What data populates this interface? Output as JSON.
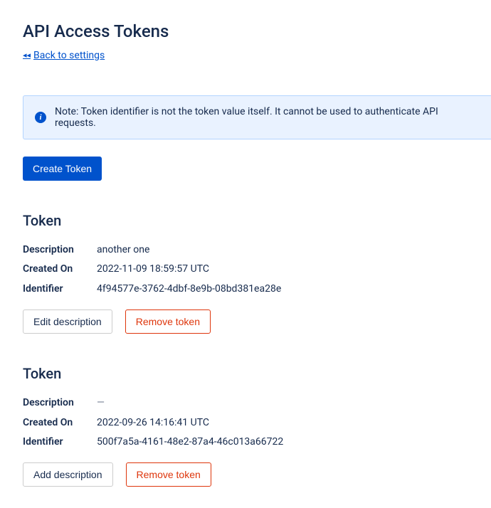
{
  "page": {
    "title": "API Access Tokens",
    "back_link": "Back to settings"
  },
  "note": {
    "text": "Note: Token identifier is not the token value itself. It cannot be used to authenticate API requests."
  },
  "create_button": "Create Token",
  "labels": {
    "section_heading": "Token",
    "description": "Description",
    "created_on": "Created On",
    "identifier": "Identifier",
    "edit_description": "Edit description",
    "add_description": "Add description",
    "remove_token": "Remove token",
    "empty": "—"
  },
  "tokens": [
    {
      "description": "another one",
      "created_on": "2022-11-09 18:59:57 UTC",
      "identifier": "4f94577e-3762-4dbf-8e9b-08bd381ea28e",
      "has_description": true
    },
    {
      "description": "",
      "created_on": "2022-09-26 14:16:41 UTC",
      "identifier": "500f7a5a-4161-48e2-87a4-46c013a66722",
      "has_description": false
    }
  ]
}
